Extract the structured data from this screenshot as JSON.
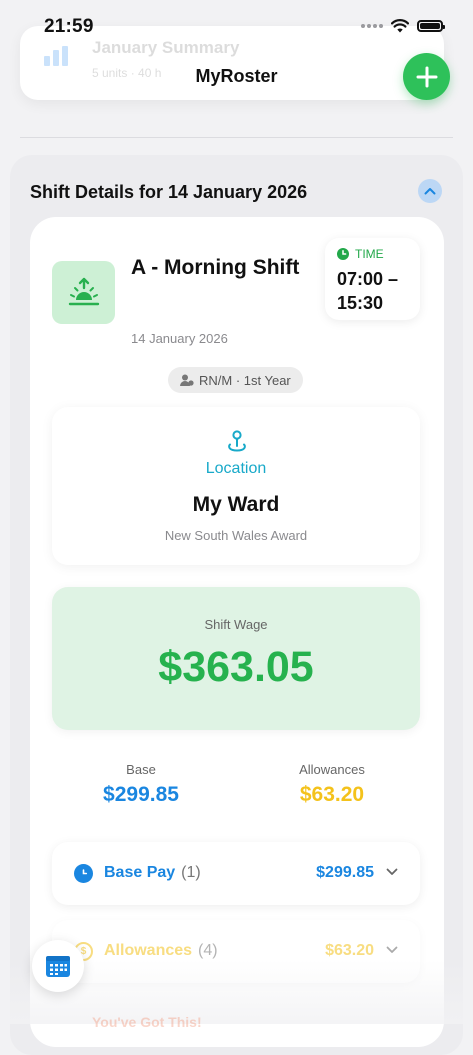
{
  "status_bar": {
    "time": "21:59"
  },
  "background_card": {
    "title": "January Summary",
    "subtitle": "5 units · 40 h"
  },
  "nav": {
    "title": "MyRoster",
    "add_icon": "plus-icon"
  },
  "section": {
    "title": "Shift Details for 14 January 2026",
    "toggle_icon": "chevron-up-icon"
  },
  "shift": {
    "name": "A - Morning Shift",
    "icon": "sunrise-icon",
    "date": "14 January 2026",
    "time_label": "TIME",
    "time_value": "07:00 – 15:30",
    "role": "RN/M · 1st Year"
  },
  "location": {
    "label": "Location",
    "name": "My Ward",
    "award": "New South Wales Award"
  },
  "wage": {
    "label": "Shift Wage",
    "value": "$363.05"
  },
  "breakdown": {
    "base_label": "Base",
    "base_value": "$299.85",
    "allowances_label": "Allowances",
    "allowances_value": "$63.20"
  },
  "rows": [
    {
      "label": "Base Pay",
      "count": "(1)",
      "amount": "$299.85"
    },
    {
      "label": "Allowances",
      "count": "(4)",
      "amount": "$63.20"
    }
  ],
  "footer_hint": "You've Got This!",
  "colors": {
    "accent_green": "#2ec15a",
    "wage_green": "#26b24e",
    "base_blue": "#1a86e0",
    "allowance_yellow": "#f4c21b",
    "location_teal": "#18a9c9"
  }
}
